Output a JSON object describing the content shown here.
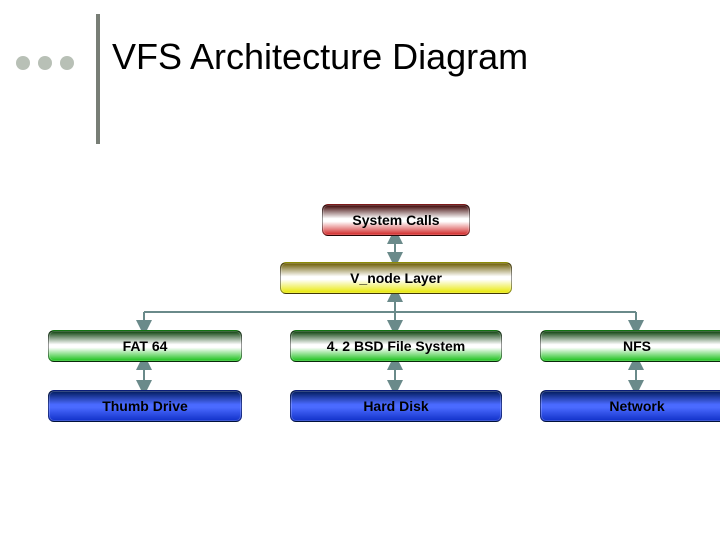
{
  "title": "VFS Architecture Diagram",
  "nodes": {
    "system_calls": "System Calls",
    "vnode_layer": "V_node Layer",
    "fat64": "FAT 64",
    "bsd": "4. 2 BSD File System",
    "nfs": "NFS",
    "thumb": "Thumb Drive",
    "hard_disk": "Hard Disk",
    "network": "Network"
  }
}
